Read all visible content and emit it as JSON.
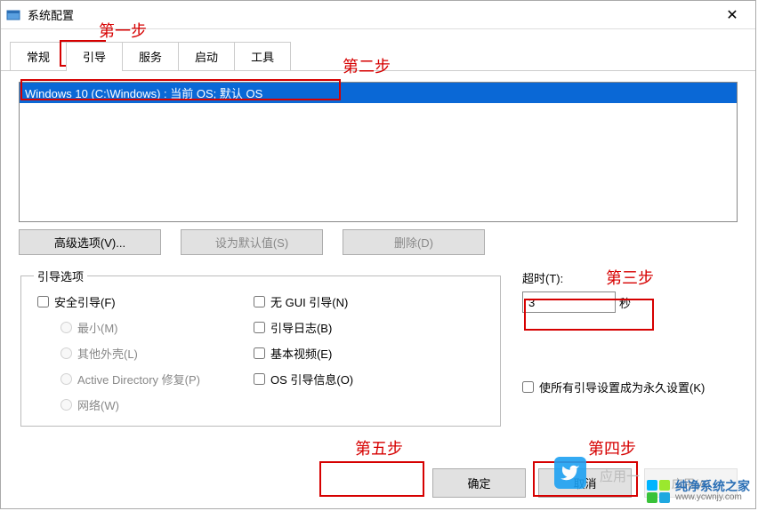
{
  "window": {
    "title": "系统配置"
  },
  "tabs": [
    "常规",
    "引导",
    "服务",
    "启动",
    "工具"
  ],
  "active_tab": 1,
  "boot_list": {
    "selected": "Windows 10 (C:\\Windows) : 当前 OS; 默认 OS"
  },
  "buttons": {
    "advanced": "高级选项(V)...",
    "set_default": "设为默认值(S)",
    "delete": "删除(D)"
  },
  "boot_options": {
    "legend": "引导选项",
    "safe_boot": "安全引导(F)",
    "minimal": "最小(M)",
    "alt_shell": "其他外壳(L)",
    "ad_repair": "Active Directory 修复(P)",
    "network": "网络(W)",
    "no_gui": "无 GUI 引导(N)",
    "boot_log": "引导日志(B)",
    "base_video": "基本视频(E)",
    "os_boot_info": "OS 引导信息(O)"
  },
  "timeout": {
    "label": "超时(T):",
    "value": "3",
    "unit": "秒"
  },
  "permanent": "使所有引导设置成为永久设置(K)",
  "footer": {
    "ok": "确定",
    "cancel": "取消",
    "apply": "应用(A)"
  },
  "annotations": {
    "step1": "第一步",
    "step2": "第二步",
    "step3": "第三步",
    "step4": "第四步",
    "step5": "第五步"
  },
  "watermark": {
    "brand": "纯净系统之家",
    "url": "www.ycwnjy.com",
    "faint": "应用一"
  }
}
